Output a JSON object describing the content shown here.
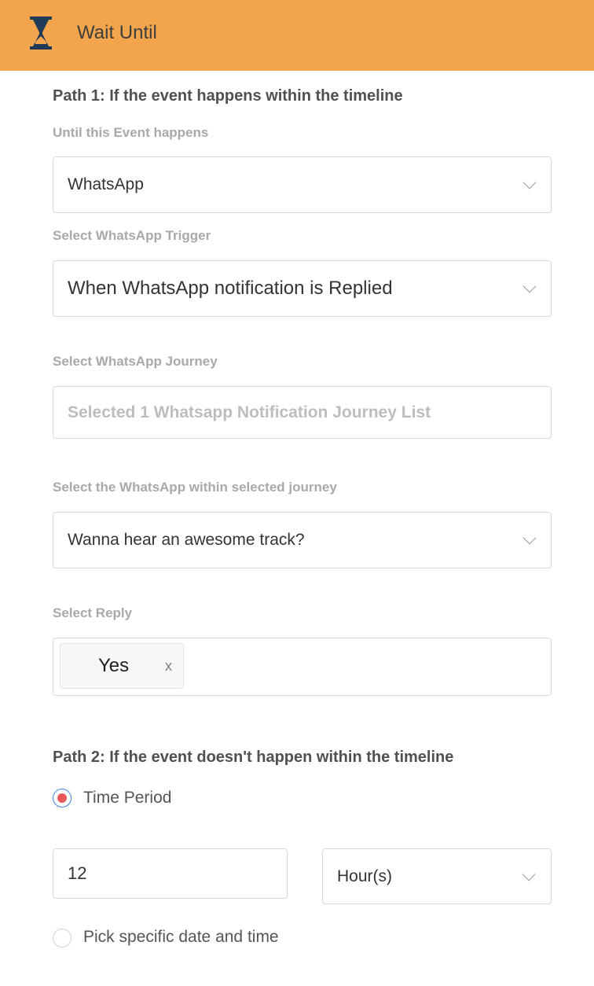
{
  "header": {
    "title": "Wait Until",
    "icon": "hourglass-icon",
    "background_color": "#f2a54c"
  },
  "path1": {
    "title": "Path 1: If the event happens within the timeline",
    "event_label": "Until this Event happens",
    "event_value": "WhatsApp",
    "trigger_label": "Select WhatsApp Trigger",
    "trigger_value": "When WhatsApp notification is Replied",
    "journey_label": "Select WhatsApp Journey",
    "journey_placeholder": "Selected 1 Whatsapp Notification Journey List",
    "whatsapp_label": "Select the WhatsApp within selected journey",
    "whatsapp_value": "Wanna hear an awesome track?",
    "reply_label": "Select Reply",
    "reply_chips": [
      {
        "label": "Yes",
        "remove": "x"
      }
    ]
  },
  "path2": {
    "title": "Path 2: If the event doesn't happen within the timeline",
    "options": [
      {
        "label": "Time Period",
        "selected": true
      },
      {
        "label": "Pick specific date and time",
        "selected": false
      }
    ],
    "time_value": "12",
    "time_unit": "Hour(s)"
  },
  "colors": {
    "accent": "#f2a54c",
    "radio_selected_border": "#3f82e8",
    "radio_selected_dot": "#e85a5a",
    "icon_dark": "#1f3b57"
  }
}
